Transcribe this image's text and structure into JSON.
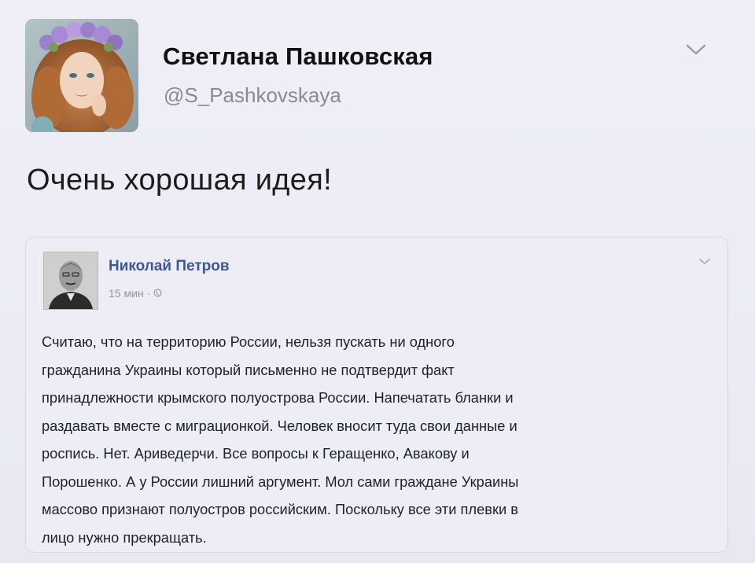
{
  "tweet": {
    "author_name": "Светлана Пашковская",
    "author_handle": "@S_Pashkovskaya",
    "text": "Очень хорошая идея!",
    "menu_icon": "chevron-down-icon",
    "avatar_icon": "avatar"
  },
  "embedded_post": {
    "author_name": "Николай Петров",
    "time": "15 мин",
    "separator": "·",
    "audience_icon": "globe-icon",
    "menu_icon": "chevron-down-icon",
    "lines": [
      "Считаю, что на территорию России, нельзя пускать ни одного",
      "гражданина Украины который письменно не подтвердит факт",
      "принадлежности крымского полуострова России. Напечатать бланки и",
      "раздавать вместе с миграционкой. Человек вносит туда свои данные и",
      "роспись. Нет. Ариведерчи. Все вопросы к Геращенко, Авакову и",
      "Порошенко. А у России лишний аргумент. Мол сами граждане Украины",
      "массово признают полуостров российским. Поскольку все эти плевки в",
      "лицо нужно прекращать."
    ]
  },
  "colors": {
    "background": "#eeedf5",
    "fb_name": "#3b5998",
    "handle": "#8a8a95"
  }
}
